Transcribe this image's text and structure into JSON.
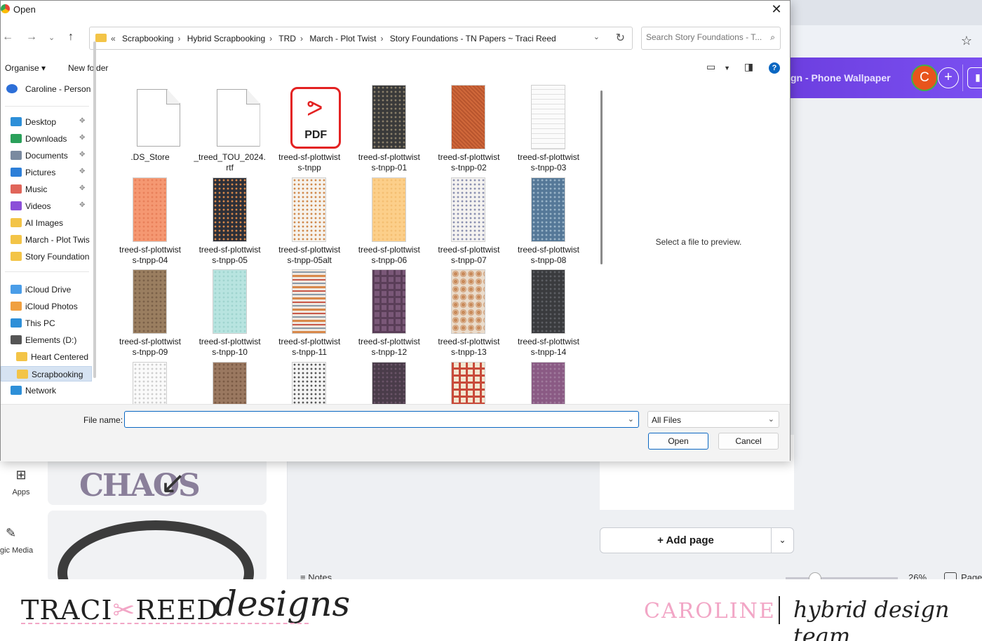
{
  "background": {
    "design_title": "gn - Phone Wallpaper",
    "avatar_letter": "C",
    "rail": [
      {
        "label": "Apps",
        "icon": "apps-icon"
      },
      {
        "label": "gic Media",
        "icon": "magic-media-icon"
      }
    ],
    "add_page_label": "+ Add page",
    "notes_label": "Notes",
    "zoom_label": "26%",
    "pages_label": "Page"
  },
  "footer": {
    "brand_left": "TRACI",
    "brand_mid": "REED",
    "brand_script": "designs",
    "member": "CAROLINE",
    "team": "hybrid design team"
  },
  "dialog": {
    "title": "Open",
    "breadcrumb": [
      "Scrapbooking",
      "Hybrid Scrapbooking",
      "TRD",
      "March - Plot Twist",
      "Story Foundations - TN Papers ~ Traci Reed"
    ],
    "search_placeholder": "Search Story Foundations - T...",
    "organise_label": "Organise",
    "new_folder_label": "New folder",
    "nav_account": "Caroline - Person",
    "nav": [
      {
        "label": "Desktop",
        "icon": "desktop-icon",
        "color": "#2d8fd8",
        "pinned": true
      },
      {
        "label": "Downloads",
        "icon": "download-icon",
        "color": "#2aa05a",
        "pinned": true
      },
      {
        "label": "Documents",
        "icon": "documents-icon",
        "color": "#7a8aa0",
        "pinned": true
      },
      {
        "label": "Pictures",
        "icon": "pictures-icon",
        "color": "#2d7fd8",
        "pinned": true
      },
      {
        "label": "Music",
        "icon": "music-icon",
        "color": "#e0655a",
        "pinned": true
      },
      {
        "label": "Videos",
        "icon": "videos-icon",
        "color": "#8b4fd8",
        "pinned": true
      },
      {
        "label": "AI Images",
        "icon": "folder-icon",
        "color": "#f3c447",
        "pinned": false
      },
      {
        "label": "March - Plot Twis",
        "icon": "folder-icon",
        "color": "#f3c447",
        "pinned": false
      },
      {
        "label": "Story Foundation",
        "icon": "folder-icon",
        "color": "#f3c447",
        "pinned": false
      }
    ],
    "nav2": [
      {
        "label": "iCloud Drive",
        "icon": "icloud-drive-icon",
        "color": "#4a9de8"
      },
      {
        "label": "iCloud Photos",
        "icon": "icloud-photos-icon",
        "color": "#f0a040"
      },
      {
        "label": "This PC",
        "icon": "pc-icon",
        "color": "#2d8fd8"
      },
      {
        "label": "Elements (D:)",
        "icon": "drive-icon",
        "color": "#555555"
      },
      {
        "label": "Heart Centered",
        "icon": "folder-icon",
        "color": "#f3c447"
      },
      {
        "label": "Scrapbooking",
        "icon": "folder-icon",
        "color": "#f3c447"
      },
      {
        "label": "Network",
        "icon": "network-icon",
        "color": "#2d8fd8"
      }
    ],
    "files": [
      {
        "name": ".DS_Store",
        "kind": "doc"
      },
      {
        "name": "_treed_TOU_2024.\nrtf",
        "kind": "doc"
      },
      {
        "name": "treed-sf-plottwist\ns-tnpp",
        "kind": "pdf"
      },
      {
        "name": "treed-sf-plottwist\ns-tnpp-01",
        "kind": "paper",
        "bg": "#3a3a3a",
        "fg": "#8a7f6a",
        "pattern": "dots"
      },
      {
        "name": "treed-sf-plottwist\ns-tnpp-02",
        "kind": "paper",
        "bg": "#d0683a",
        "fg": "#b8552e",
        "pattern": "weave"
      },
      {
        "name": "treed-sf-plottwist\ns-tnpp-03",
        "kind": "paper",
        "bg": "#fbfbfb",
        "fg": "#e0e0e0",
        "pattern": "lines"
      },
      {
        "name": "treed-sf-plottwist\ns-tnpp-04",
        "kind": "paper",
        "bg": "#f59872",
        "fg": "#e8805a",
        "pattern": "dots"
      },
      {
        "name": "treed-sf-plottwist\ns-tnpp-05",
        "kind": "paper",
        "bg": "#2e3038",
        "fg": "#d8884a",
        "pattern": "dots"
      },
      {
        "name": "treed-sf-plottwist\ns-tnpp-05alt",
        "kind": "paper",
        "bg": "#f6f2ec",
        "fg": "#d0884a",
        "pattern": "dots"
      },
      {
        "name": "treed-sf-plottwist\ns-tnpp-06",
        "kind": "paper",
        "bg": "#fccf8a",
        "fg": "#f4bf72",
        "pattern": "dots"
      },
      {
        "name": "treed-sf-plottwist\ns-tnpp-07",
        "kind": "paper",
        "bg": "#f4f2f0",
        "fg": "#8a8fb0",
        "pattern": "dots"
      },
      {
        "name": "treed-sf-plottwist\ns-tnpp-08",
        "kind": "paper",
        "bg": "#557898",
        "fg": "#9ab4c8",
        "pattern": "dots"
      },
      {
        "name": "treed-sf-plottwist\ns-tnpp-09",
        "kind": "paper",
        "bg": "#9a7e60",
        "fg": "#7a6048",
        "pattern": "dots"
      },
      {
        "name": "treed-sf-plottwist\ns-tnpp-10",
        "kind": "paper",
        "bg": "#b8e4e0",
        "fg": "#a0d4cf",
        "pattern": "dots"
      },
      {
        "name": "treed-sf-plottwist\ns-tnpp-11",
        "kind": "paper",
        "bg": "#f0e8e0",
        "fg": "#d8884a",
        "pattern": "stripes"
      },
      {
        "name": "treed-sf-plottwist\ns-tnpp-12",
        "kind": "paper",
        "bg": "#7a5878",
        "fg": "#5a3e58",
        "pattern": "plaid"
      },
      {
        "name": "treed-sf-plottwist\ns-tnpp-13",
        "kind": "paper",
        "bg": "#eadccc",
        "fg": "#c88a5a",
        "pattern": "circles"
      },
      {
        "name": "treed-sf-plottwist\ns-tnpp-14",
        "kind": "paper",
        "bg": "#3a3b3e",
        "fg": "#5e5f64",
        "pattern": "dots"
      },
      {
        "name": "",
        "kind": "paper",
        "bg": "#fafafa",
        "fg": "#cfcfcf",
        "pattern": "dots"
      },
      {
        "name": "",
        "kind": "paper",
        "bg": "#9a7860",
        "fg": "#7a5a44",
        "pattern": "dots"
      },
      {
        "name": "",
        "kind": "paper",
        "bg": "#f4f4f4",
        "fg": "#555555",
        "pattern": "dots"
      },
      {
        "name": "",
        "kind": "paper",
        "bg": "#4a3c4a",
        "fg": "#6a5468",
        "pattern": "dots"
      },
      {
        "name": "",
        "kind": "paper",
        "bg": "#f2e6d0",
        "fg": "#c84a3a",
        "pattern": "plaid"
      },
      {
        "name": "",
        "kind": "paper",
        "bg": "#8a5a84",
        "fg": "#a07a9c",
        "pattern": "dots"
      }
    ],
    "preview_message": "Select a file to preview.",
    "file_name_label": "File name:",
    "file_name_value": "",
    "file_type": "All Files",
    "open_label": "Open",
    "cancel_label": "Cancel"
  }
}
